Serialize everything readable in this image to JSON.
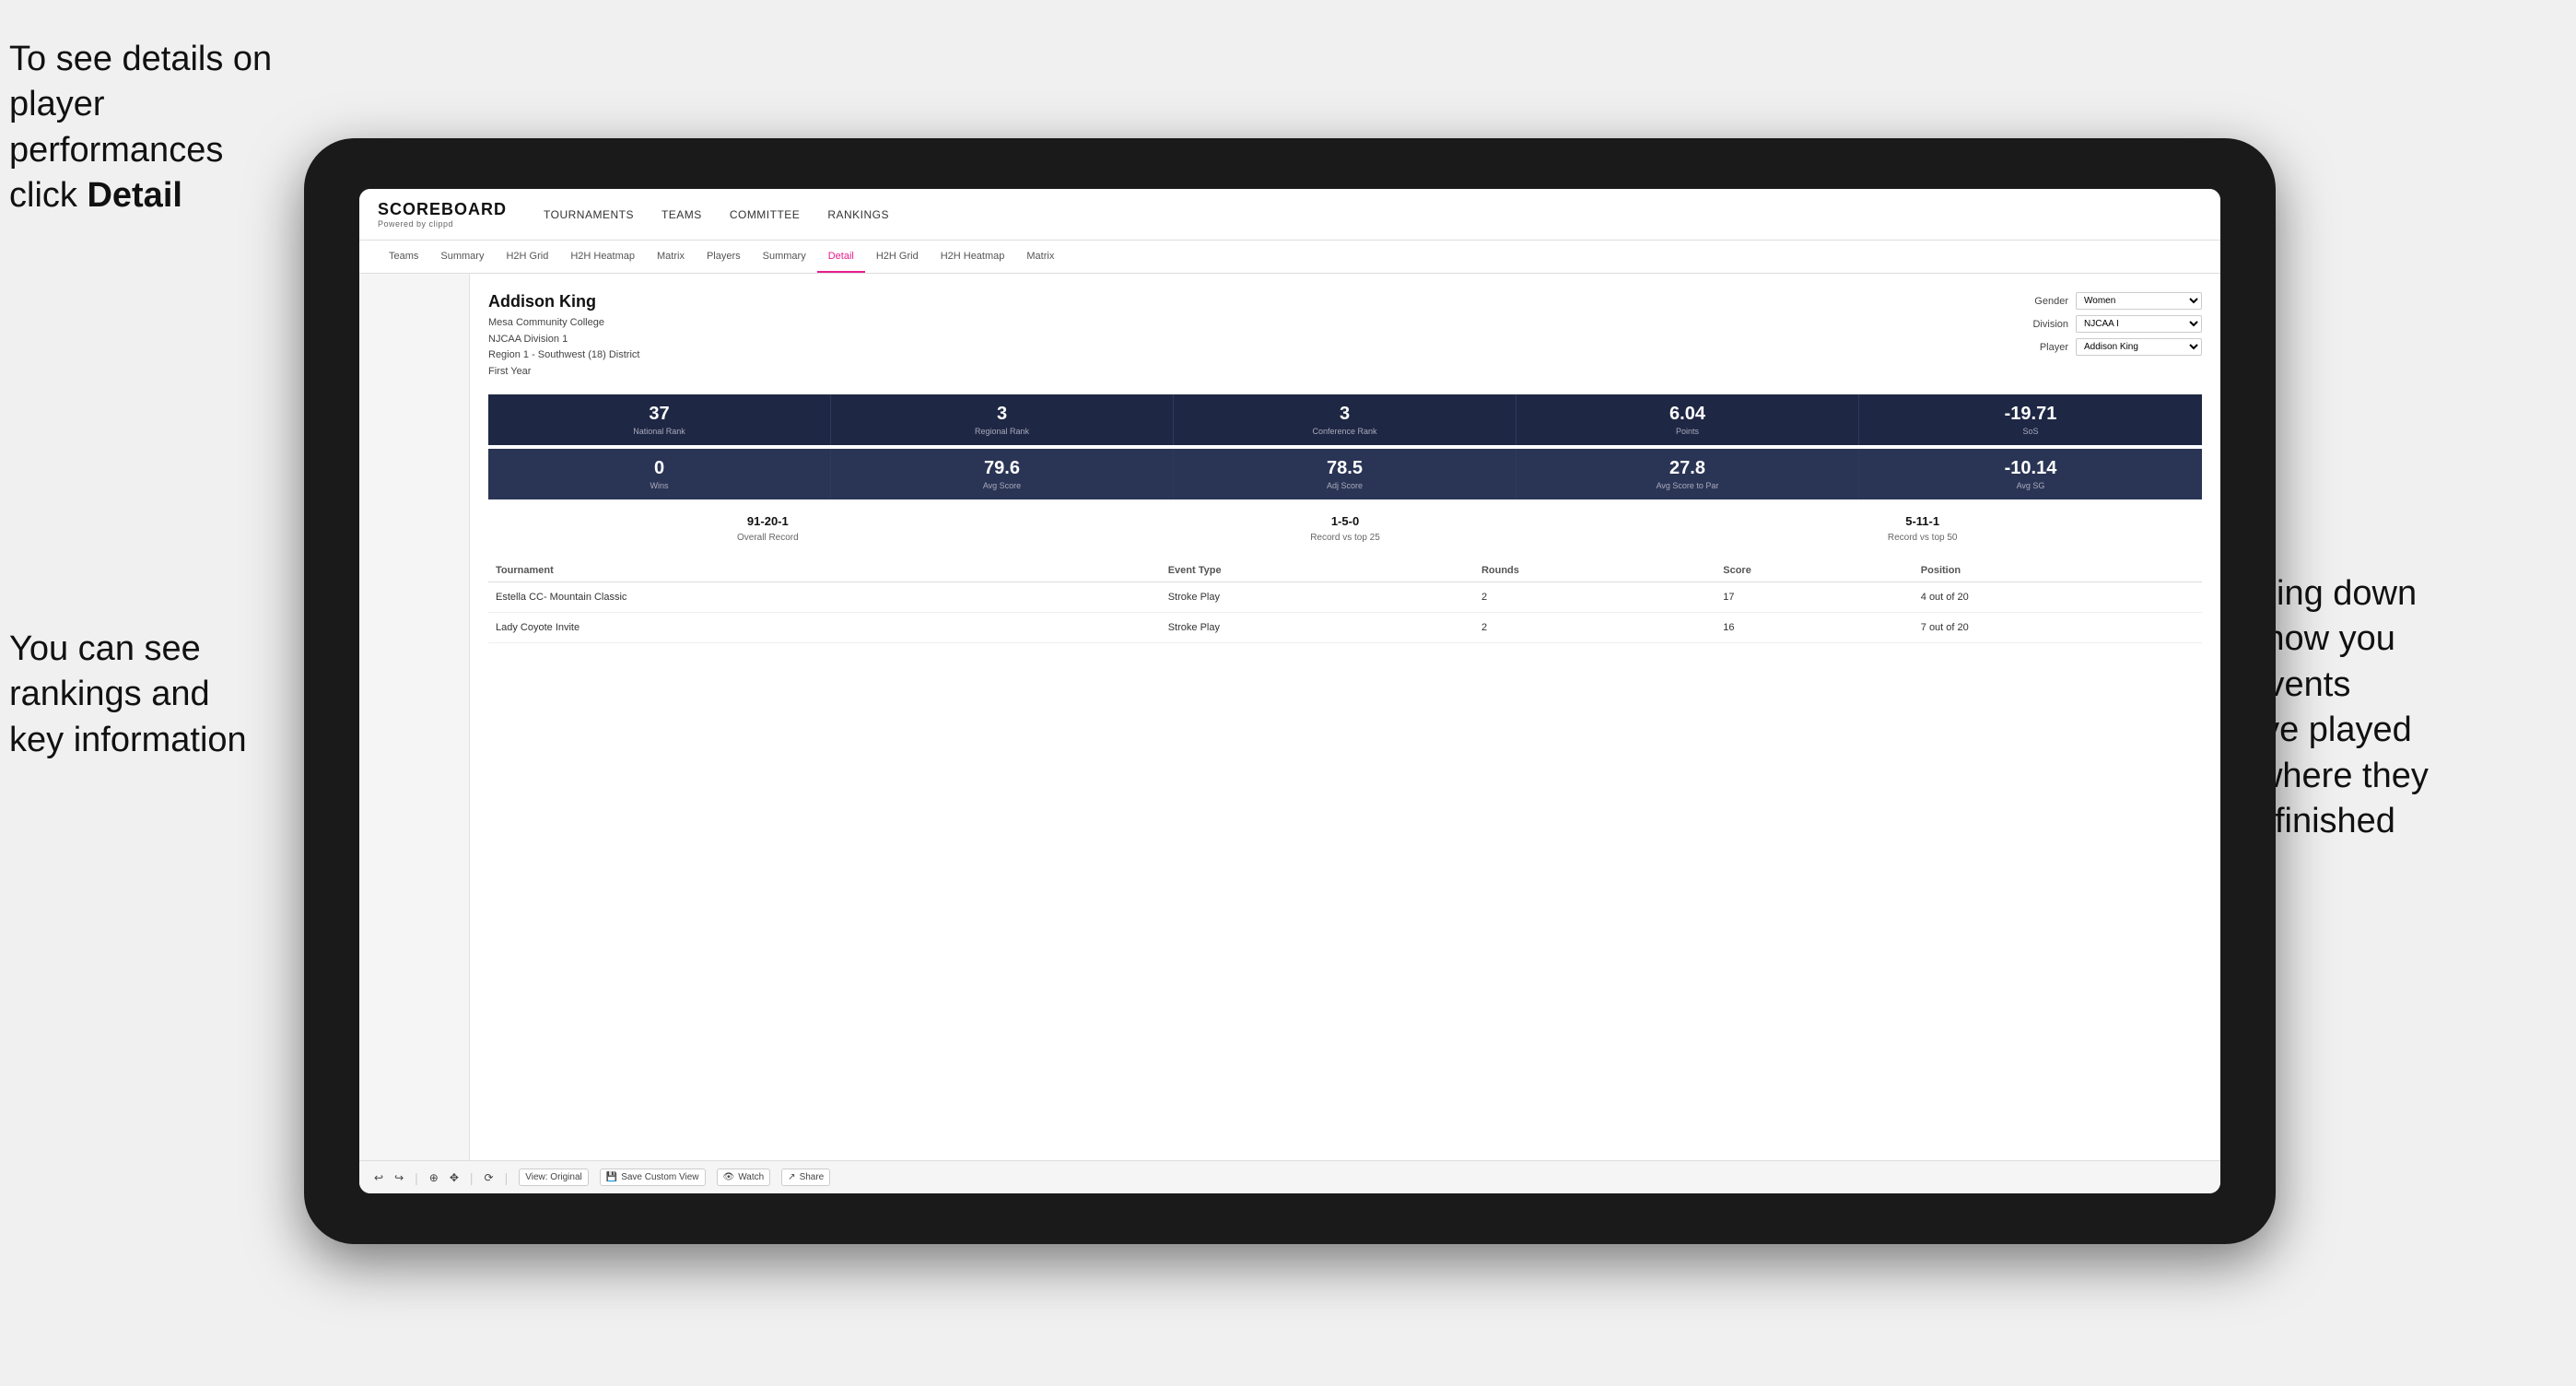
{
  "annotations": {
    "top_left": {
      "line1": "To see details on",
      "line2": "player performances",
      "line3_normal": "click ",
      "line3_bold": "Detail"
    },
    "bottom_left": {
      "line1": "You can see",
      "line2": "rankings and",
      "line3": "key information"
    },
    "right": {
      "line1": "Scrolling down",
      "line2": "will show you",
      "line3": "the events",
      "line4": "they've played",
      "line5": "and where they",
      "line6": "have finished"
    }
  },
  "nav": {
    "logo": "SCOREBOARD",
    "logo_sub": "Powered by clippd",
    "items": [
      "TOURNAMENTS",
      "TEAMS",
      "COMMITTEE",
      "RANKINGS"
    ]
  },
  "sub_nav": {
    "items": [
      "Teams",
      "Summary",
      "H2H Grid",
      "H2H Heatmap",
      "Matrix",
      "Players",
      "Summary",
      "Detail",
      "H2H Grid",
      "H2H Heatmap",
      "Matrix"
    ]
  },
  "player": {
    "name": "Addison King",
    "college": "Mesa Community College",
    "division": "NJCAA Division 1",
    "region": "Region 1 - Southwest (18) District",
    "year": "First Year"
  },
  "controls": {
    "gender_label": "Gender",
    "gender_value": "Women",
    "division_label": "Division",
    "division_value": "NJCAA I",
    "player_label": "Player",
    "player_value": "Addison King"
  },
  "stats_row1": [
    {
      "value": "37",
      "label": "National Rank"
    },
    {
      "value": "3",
      "label": "Regional Rank"
    },
    {
      "value": "3",
      "label": "Conference Rank"
    },
    {
      "value": "6.04",
      "label": "Points"
    },
    {
      "value": "-19.71",
      "label": "SoS"
    }
  ],
  "stats_row2": [
    {
      "value": "0",
      "label": "Wins"
    },
    {
      "value": "79.6",
      "label": "Avg Score"
    },
    {
      "value": "78.5",
      "label": "Adj Score"
    },
    {
      "value": "27.8",
      "label": "Avg Score to Par"
    },
    {
      "value": "-10.14",
      "label": "Avg SG"
    }
  ],
  "records": [
    {
      "value": "91-20-1",
      "label": "Overall Record"
    },
    {
      "value": "1-5-0",
      "label": "Record vs top 25"
    },
    {
      "value": "5-11-1",
      "label": "Record vs top 50"
    }
  ],
  "table": {
    "headers": [
      "Tournament",
      "Event Type",
      "Rounds",
      "Score",
      "Position"
    ],
    "rows": [
      {
        "tournament": "Estella CC- Mountain Classic",
        "event_type": "Stroke Play",
        "rounds": "2",
        "score": "17",
        "position": "4 out of 20"
      },
      {
        "tournament": "Lady Coyote Invite",
        "event_type": "Stroke Play",
        "rounds": "2",
        "score": "16",
        "position": "7 out of 20"
      }
    ]
  },
  "toolbar": {
    "view_original": "View: Original",
    "save_custom": "Save Custom View",
    "watch": "Watch",
    "share": "Share"
  }
}
